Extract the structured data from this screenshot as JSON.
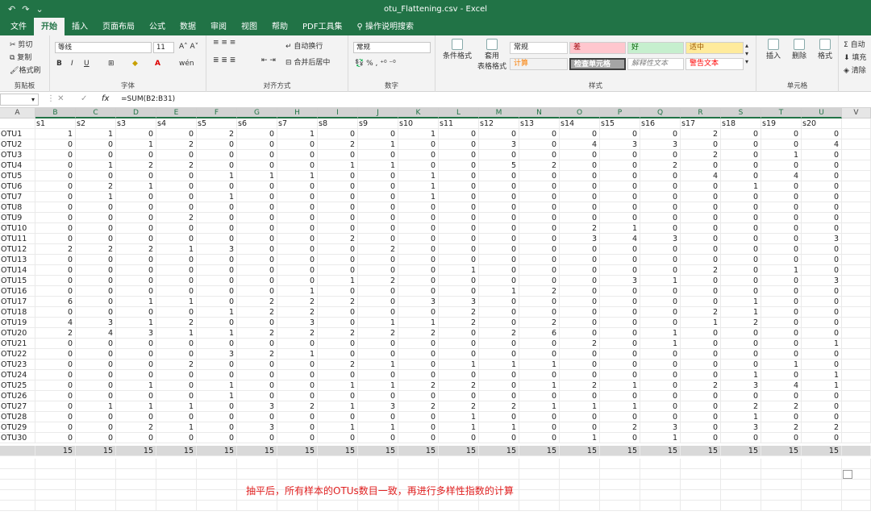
{
  "window": {
    "title": "otu_Flattening.csv  -  Excel"
  },
  "quick_access": [
    "↶",
    "↷",
    "⌄"
  ],
  "tabs": [
    "文件",
    "开始",
    "插入",
    "页面布局",
    "公式",
    "数据",
    "审阅",
    "视图",
    "帮助",
    "PDF工具集",
    "操作说明搜索"
  ],
  "ribbon": {
    "clipboard": {
      "cut": "剪切",
      "copy": "复制",
      "paste_format": "格式刷",
      "label": "剪贴板"
    },
    "font": {
      "name": "等线",
      "size": "11",
      "label": "字体"
    },
    "alignment": {
      "wrap": "自动换行",
      "merge": "合并后居中",
      "label": "对齐方式"
    },
    "number": {
      "format": "常规",
      "label": "数字"
    },
    "styles": {
      "cond_format": "条件格式",
      "table_format": "套用\n表格格式",
      "normal": "常规",
      "bad": "差",
      "good": "好",
      "neutral": "适中",
      "calc": "计算",
      "check": "检查单元格",
      "explain": "解释性文本",
      "warn": "警告文本",
      "label": "样式"
    },
    "cells": {
      "insert": "插入",
      "delete": "删除",
      "format": "格式",
      "label": "单元格"
    },
    "editing": {
      "autosum": "自动",
      "fill": "填充",
      "clear": "清除"
    }
  },
  "formula_bar": {
    "formula": "=SUM(B2:B31)"
  },
  "columns": [
    "A",
    "B",
    "C",
    "D",
    "E",
    "F",
    "G",
    "H",
    "I",
    "J",
    "K",
    "L",
    "M",
    "N",
    "O",
    "P",
    "Q",
    "R",
    "S",
    "T",
    "U",
    "V"
  ],
  "header_row": [
    "",
    "s1",
    "s2",
    "s3",
    "s4",
    "s5",
    "s6",
    "s7",
    "s8",
    "s9",
    "s10",
    "s11",
    "s12",
    "s13",
    "s14",
    "s15",
    "s16",
    "s17",
    "s18",
    "s19",
    "s20"
  ],
  "rows": [
    [
      "OTU1",
      1,
      1,
      0,
      0,
      2,
      0,
      1,
      0,
      0,
      1,
      0,
      0,
      0,
      0,
      0,
      0,
      2,
      0,
      0,
      0
    ],
    [
      "OTU2",
      0,
      0,
      1,
      2,
      0,
      0,
      0,
      2,
      1,
      0,
      0,
      3,
      0,
      4,
      3,
      3,
      0,
      0,
      0,
      4
    ],
    [
      "OTU3",
      0,
      0,
      0,
      0,
      0,
      0,
      0,
      0,
      0,
      0,
      0,
      0,
      0,
      0,
      0,
      0,
      2,
      0,
      1,
      0
    ],
    [
      "OTU4",
      0,
      1,
      2,
      2,
      0,
      0,
      0,
      1,
      1,
      0,
      0,
      5,
      2,
      0,
      0,
      2,
      0,
      0,
      0,
      0
    ],
    [
      "OTU5",
      0,
      0,
      0,
      0,
      1,
      1,
      1,
      0,
      0,
      1,
      0,
      0,
      0,
      0,
      0,
      0,
      4,
      0,
      4,
      0
    ],
    [
      "OTU6",
      0,
      2,
      1,
      0,
      0,
      0,
      0,
      0,
      0,
      1,
      0,
      0,
      0,
      0,
      0,
      0,
      0,
      1,
      0,
      0
    ],
    [
      "OTU7",
      0,
      1,
      0,
      0,
      1,
      0,
      0,
      0,
      0,
      1,
      0,
      0,
      0,
      0,
      0,
      0,
      0,
      0,
      0,
      0
    ],
    [
      "OTU8",
      0,
      0,
      0,
      0,
      0,
      0,
      0,
      0,
      0,
      0,
      0,
      0,
      0,
      0,
      0,
      0,
      0,
      0,
      0,
      0
    ],
    [
      "OTU9",
      0,
      0,
      0,
      2,
      0,
      0,
      0,
      0,
      0,
      0,
      0,
      0,
      0,
      0,
      0,
      0,
      0,
      0,
      0,
      0
    ],
    [
      "OTU10",
      0,
      0,
      0,
      0,
      0,
      0,
      0,
      0,
      0,
      0,
      0,
      0,
      0,
      2,
      1,
      0,
      0,
      0,
      0,
      0
    ],
    [
      "OTU11",
      0,
      0,
      0,
      0,
      0,
      0,
      0,
      2,
      0,
      0,
      0,
      0,
      0,
      3,
      4,
      3,
      0,
      0,
      0,
      3
    ],
    [
      "OTU12",
      2,
      2,
      2,
      1,
      3,
      0,
      0,
      0,
      2,
      0,
      0,
      0,
      0,
      0,
      0,
      0,
      0,
      0,
      0,
      0
    ],
    [
      "OTU13",
      0,
      0,
      0,
      0,
      0,
      0,
      0,
      0,
      0,
      0,
      0,
      0,
      0,
      0,
      0,
      0,
      0,
      0,
      0,
      0
    ],
    [
      "OTU14",
      0,
      0,
      0,
      0,
      0,
      0,
      0,
      0,
      0,
      0,
      1,
      0,
      0,
      0,
      0,
      0,
      2,
      0,
      1,
      0
    ],
    [
      "OTU15",
      0,
      0,
      0,
      0,
      0,
      0,
      0,
      1,
      2,
      0,
      0,
      0,
      0,
      0,
      3,
      1,
      0,
      0,
      0,
      3
    ],
    [
      "OTU16",
      0,
      0,
      0,
      0,
      0,
      0,
      1,
      0,
      0,
      0,
      0,
      1,
      2,
      0,
      0,
      0,
      0,
      0,
      0,
      0
    ],
    [
      "OTU17",
      6,
      0,
      1,
      1,
      0,
      2,
      2,
      2,
      0,
      3,
      3,
      0,
      0,
      0,
      0,
      0,
      0,
      1,
      0,
      0
    ],
    [
      "OTU18",
      0,
      0,
      0,
      0,
      1,
      2,
      2,
      0,
      0,
      0,
      2,
      0,
      0,
      0,
      0,
      0,
      2,
      1,
      0,
      0
    ],
    [
      "OTU19",
      4,
      3,
      1,
      2,
      0,
      0,
      3,
      0,
      1,
      1,
      2,
      0,
      2,
      0,
      0,
      0,
      1,
      2,
      0,
      0
    ],
    [
      "OTU20",
      2,
      4,
      3,
      1,
      1,
      2,
      2,
      2,
      2,
      2,
      0,
      2,
      6,
      0,
      0,
      1,
      0,
      0,
      0,
      0
    ],
    [
      "OTU21",
      0,
      0,
      0,
      0,
      0,
      0,
      0,
      0,
      0,
      0,
      0,
      0,
      0,
      2,
      0,
      1,
      0,
      0,
      0,
      1
    ],
    [
      "OTU22",
      0,
      0,
      0,
      0,
      3,
      2,
      1,
      0,
      0,
      0,
      0,
      0,
      0,
      0,
      0,
      0,
      0,
      0,
      0,
      0
    ],
    [
      "OTU23",
      0,
      0,
      0,
      2,
      0,
      0,
      0,
      2,
      1,
      0,
      1,
      1,
      1,
      0,
      0,
      0,
      0,
      0,
      1,
      0
    ],
    [
      "OTU24",
      0,
      0,
      0,
      0,
      0,
      0,
      0,
      0,
      0,
      0,
      0,
      0,
      0,
      0,
      0,
      0,
      0,
      1,
      0,
      1
    ],
    [
      "OTU25",
      0,
      0,
      1,
      0,
      1,
      0,
      0,
      1,
      1,
      2,
      2,
      0,
      1,
      2,
      1,
      0,
      2,
      3,
      4,
      1
    ],
    [
      "OTU26",
      0,
      0,
      0,
      0,
      1,
      0,
      0,
      0,
      0,
      0,
      0,
      0,
      0,
      0,
      0,
      0,
      0,
      0,
      0,
      0
    ],
    [
      "OTU27",
      0,
      1,
      1,
      1,
      0,
      3,
      2,
      1,
      3,
      2,
      2,
      2,
      1,
      1,
      1,
      0,
      0,
      2,
      2,
      0
    ],
    [
      "OTU28",
      0,
      0,
      0,
      0,
      0,
      0,
      0,
      0,
      0,
      0,
      1,
      0,
      0,
      0,
      0,
      0,
      0,
      1,
      0,
      0
    ],
    [
      "OTU29",
      0,
      0,
      2,
      1,
      0,
      3,
      0,
      1,
      1,
      0,
      1,
      1,
      0,
      0,
      2,
      3,
      0,
      3,
      2,
      2
    ],
    [
      "OTU30",
      0,
      0,
      0,
      0,
      0,
      0,
      0,
      0,
      0,
      0,
      0,
      0,
      0,
      1,
      0,
      1,
      0,
      0,
      0,
      0
    ]
  ],
  "sum_row": [
    "",
    15,
    15,
    15,
    15,
    15,
    15,
    15,
    15,
    15,
    15,
    15,
    15,
    15,
    15,
    15,
    15,
    15,
    15,
    15,
    15
  ],
  "annotation": "抽平后，所有样本的OTUs数目一致，再进行多样性指数的计算"
}
